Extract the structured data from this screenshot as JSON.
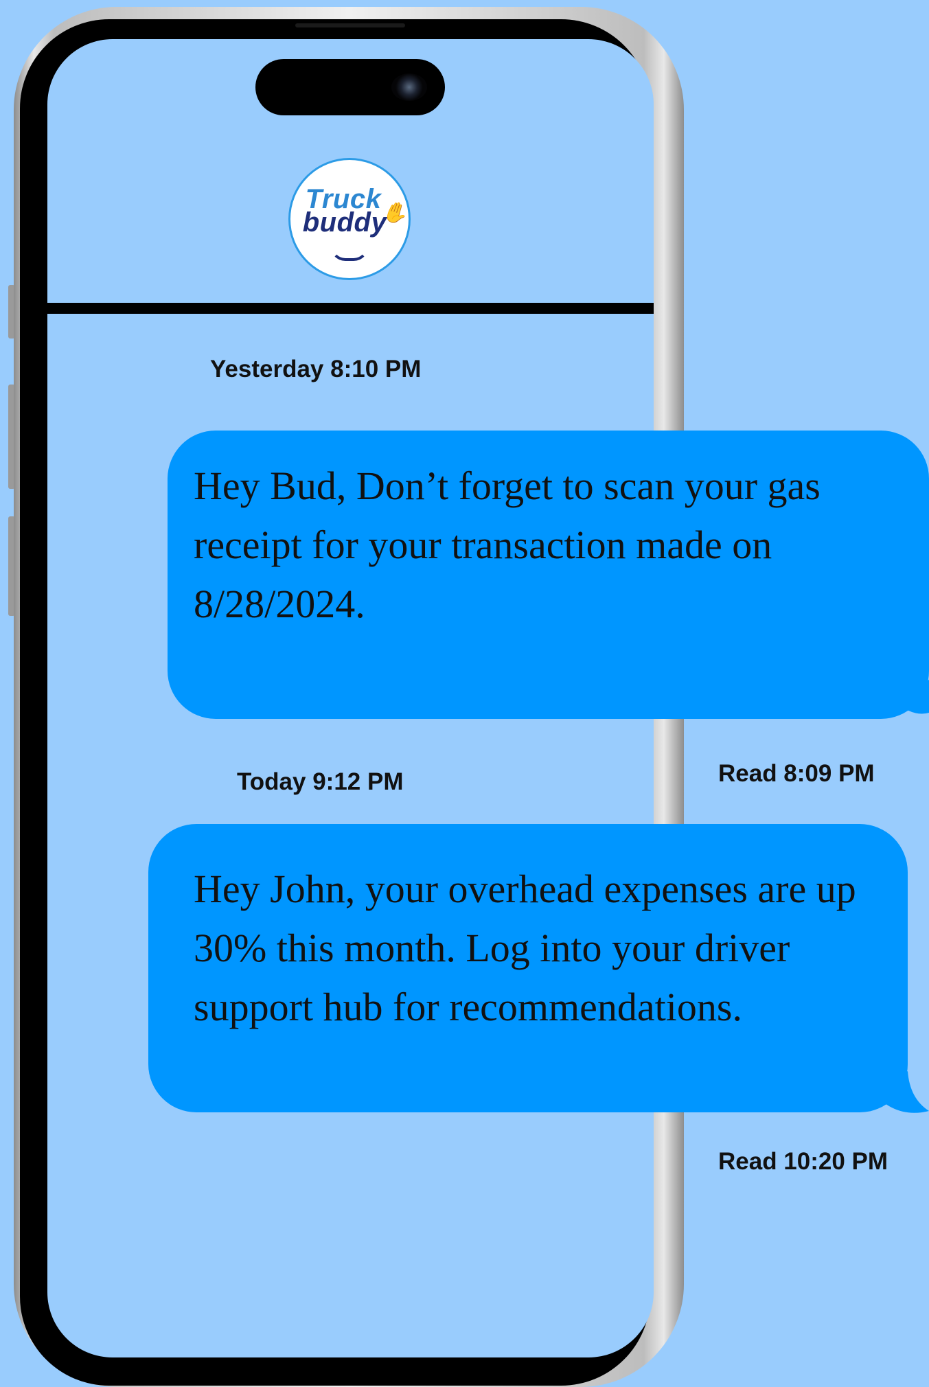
{
  "brand": {
    "logo_line1": "Truck",
    "logo_line2": "buddy",
    "colors": {
      "background": "#99ccfd",
      "bubble": "#0096ff",
      "logo_blue": "#2c87d1",
      "logo_navy": "#1e2e7a"
    }
  },
  "messages": [
    {
      "timestamp": "Yesterday 8:10 PM",
      "text": "Hey Bud, Don’t forget to scan your gas receipt for your transaction made on 8/28/2024.",
      "read_receipt": "Read 8:09 PM"
    },
    {
      "timestamp": "Today 9:12 PM",
      "text": "Hey John, your overhead expenses are up 30% this month. Log into your driver support hub for recommendations.",
      "read_receipt": "Read 10:20 PM"
    }
  ],
  "icons": {
    "logo_hand": "waving-hand-icon",
    "camera": "camera-lens-icon"
  }
}
